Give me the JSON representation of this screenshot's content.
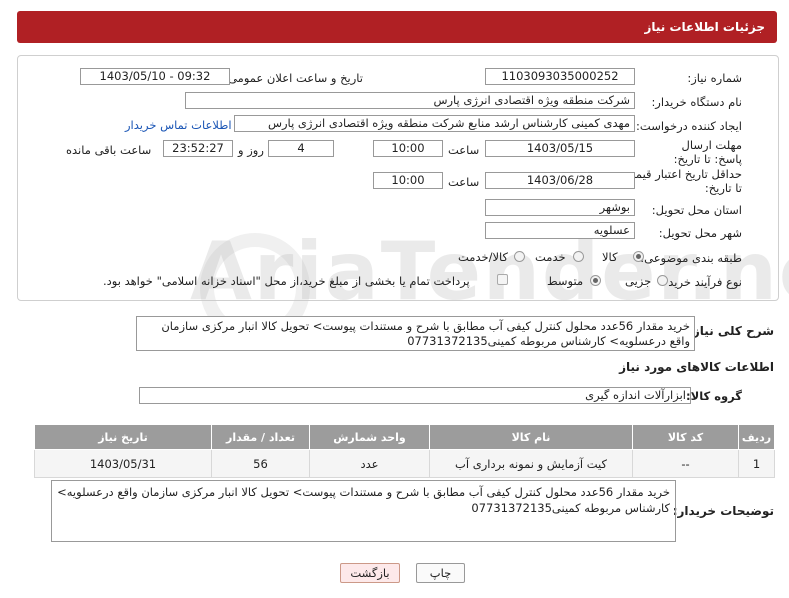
{
  "header": {
    "title": "جزئیات اطلاعات نیاز"
  },
  "form": {
    "need_number_label": "شماره نیاز:",
    "need_number": "1103093035000252",
    "announce_label": "تاریخ و ساعت اعلان عمومی:",
    "announce_value": "1403/05/10 - 09:32",
    "buyer_org_label": "نام دستگاه خریدار:",
    "buyer_org": "شرکت منطقه ویژه اقتصادی انرژی پارس",
    "requester_label": "ایجاد کننده درخواست:",
    "requester": "مهدی کمینی کارشناس ارشد منابع شرکت منطقه ویژه اقتصادی انرژی پارس",
    "contact_link": "اطلاعات تماس خریدار",
    "deadline_label": "مهلت ارسال پاسخ: تا تاریخ:",
    "deadline_date": "1403/05/15",
    "time_label": "ساعت",
    "deadline_time": "10:00",
    "days_value": "4",
    "days_label": "روز و",
    "remaining_time": "23:52:27",
    "remaining_label": "ساعت باقی مانده",
    "validity_label": "حداقل تاریخ اعتبار قیمت: تا تاریخ:",
    "validity_date": "1403/06/28",
    "validity_time": "10:00",
    "province_label": "استان محل تحویل:",
    "province": "بوشهر",
    "city_label": "شهر محل تحویل:",
    "city": "عسلویه",
    "category_label": "طبقه بندی موضوعی:",
    "category_options": [
      "کالا",
      "خدمت",
      "کالا/خدمت"
    ],
    "process_label": "نوع فرآیند خرید :",
    "process_options": [
      "جزیی",
      "متوسط"
    ],
    "payment_note": "پرداخت تمام یا بخشی از مبلغ خرید،از محل \"اسناد خزانه اسلامی\" خواهد بود."
  },
  "description": {
    "label": "شرح کلی نیاز:",
    "text": "خرید مقدار 56عدد محلول کنترل کیفی آب مطابق با شرح  و مستندات پیوست> تحویل کالا انبار مرکزی سازمان  واقع درعسلویه> کارشناس مربوطه کمینی07731372135"
  },
  "goods_section": {
    "title": "اطلاعات کالاهای مورد نیاز"
  },
  "goods_group": {
    "label": "گروه کالا:",
    "value": "ابزارآلات اندازه گیری"
  },
  "table": {
    "headers": [
      "ردیف",
      "کد کالا",
      "نام کالا",
      "واحد شمارش",
      "تعداد / مقدار",
      "تاریخ نیاز"
    ],
    "rows": [
      [
        "1",
        "--",
        "کیت آزمایش و نمونه برداری آب",
        "عدد",
        "56",
        "1403/05/31"
      ]
    ]
  },
  "buyer_notes": {
    "label": "توضیحات خریدار:",
    "text": "خرید مقدار 56عدد محلول کنترل کیفی آب مطابق با شرح  و مستندات پیوست> تحویل کالا انبار مرکزی سازمان  واقع درعسلویه> کارشناس مربوطه کمینی07731372135"
  },
  "buttons": {
    "print": "چاپ",
    "back": "بازگشت"
  },
  "watermark": "AriaTender.neT"
}
